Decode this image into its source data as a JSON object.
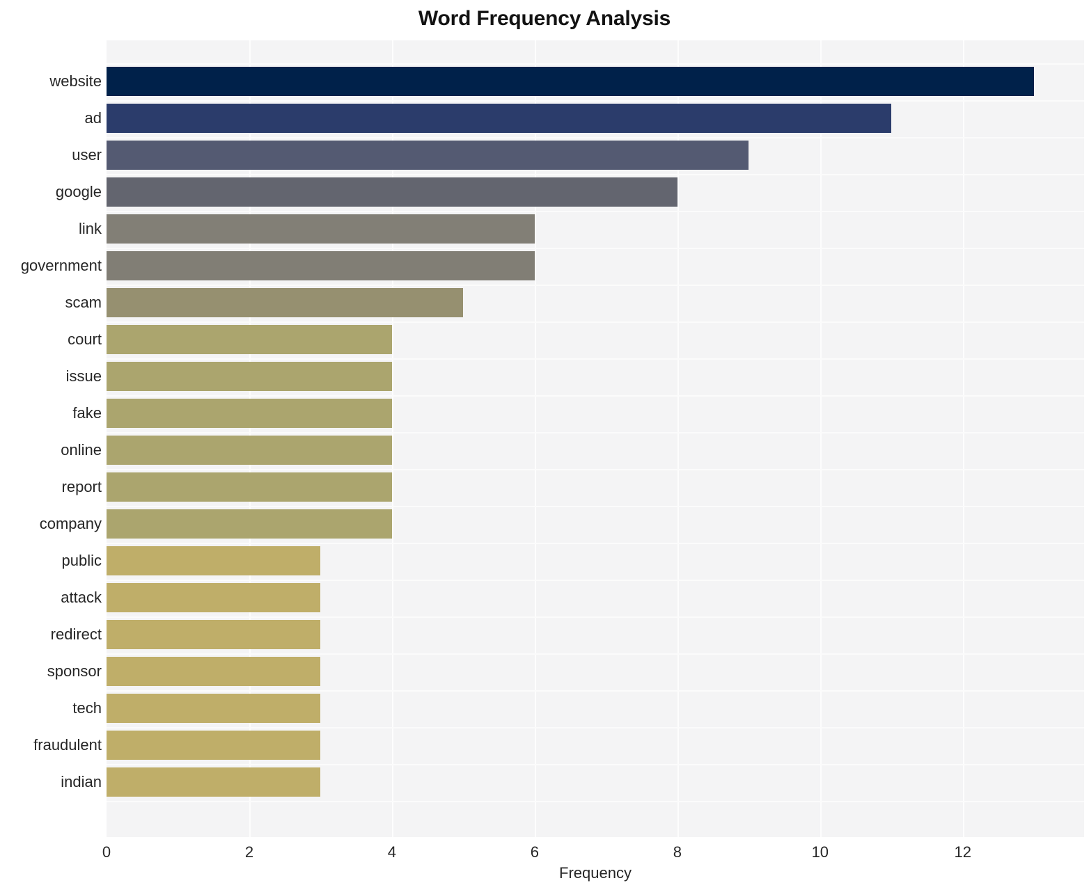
{
  "chart_data": {
    "type": "bar",
    "orientation": "horizontal",
    "title": "Word Frequency Analysis",
    "xlabel": "Frequency",
    "ylabel": "",
    "xlim": [
      0,
      13.7
    ],
    "xticks": [
      0,
      2,
      4,
      6,
      8,
      10,
      12
    ],
    "xticklabels": [
      "0",
      "2",
      "4",
      "6",
      "8",
      "10",
      "12"
    ],
    "grid": true,
    "legend": false,
    "categories": [
      "website",
      "ad",
      "user",
      "google",
      "link",
      "government",
      "scam",
      "court",
      "issue",
      "fake",
      "online",
      "report",
      "company",
      "public",
      "attack",
      "redirect",
      "sponsor",
      "tech",
      "fraudulent",
      "indian"
    ],
    "values": [
      13,
      11,
      9,
      8,
      6,
      6,
      5,
      4,
      4,
      4,
      4,
      4,
      4,
      3,
      3,
      3,
      3,
      3,
      3,
      3
    ],
    "bar_colors": [
      "#00214a",
      "#2b3c6b",
      "#545a72",
      "#63656f",
      "#827f76",
      "#817e75",
      "#969070",
      "#aba56e",
      "#aba56e",
      "#aba56e",
      "#aba56e",
      "#aba56e",
      "#aba56e",
      "#bfae69",
      "#bfae69",
      "#bfae69",
      "#bfae69",
      "#bfae69",
      "#bfae69",
      "#bfae69"
    ],
    "plot_background": "#f4f4f5",
    "figure_background": "#ffffff",
    "gridline_color": "#fdfdfd",
    "text_color": "#262626"
  }
}
